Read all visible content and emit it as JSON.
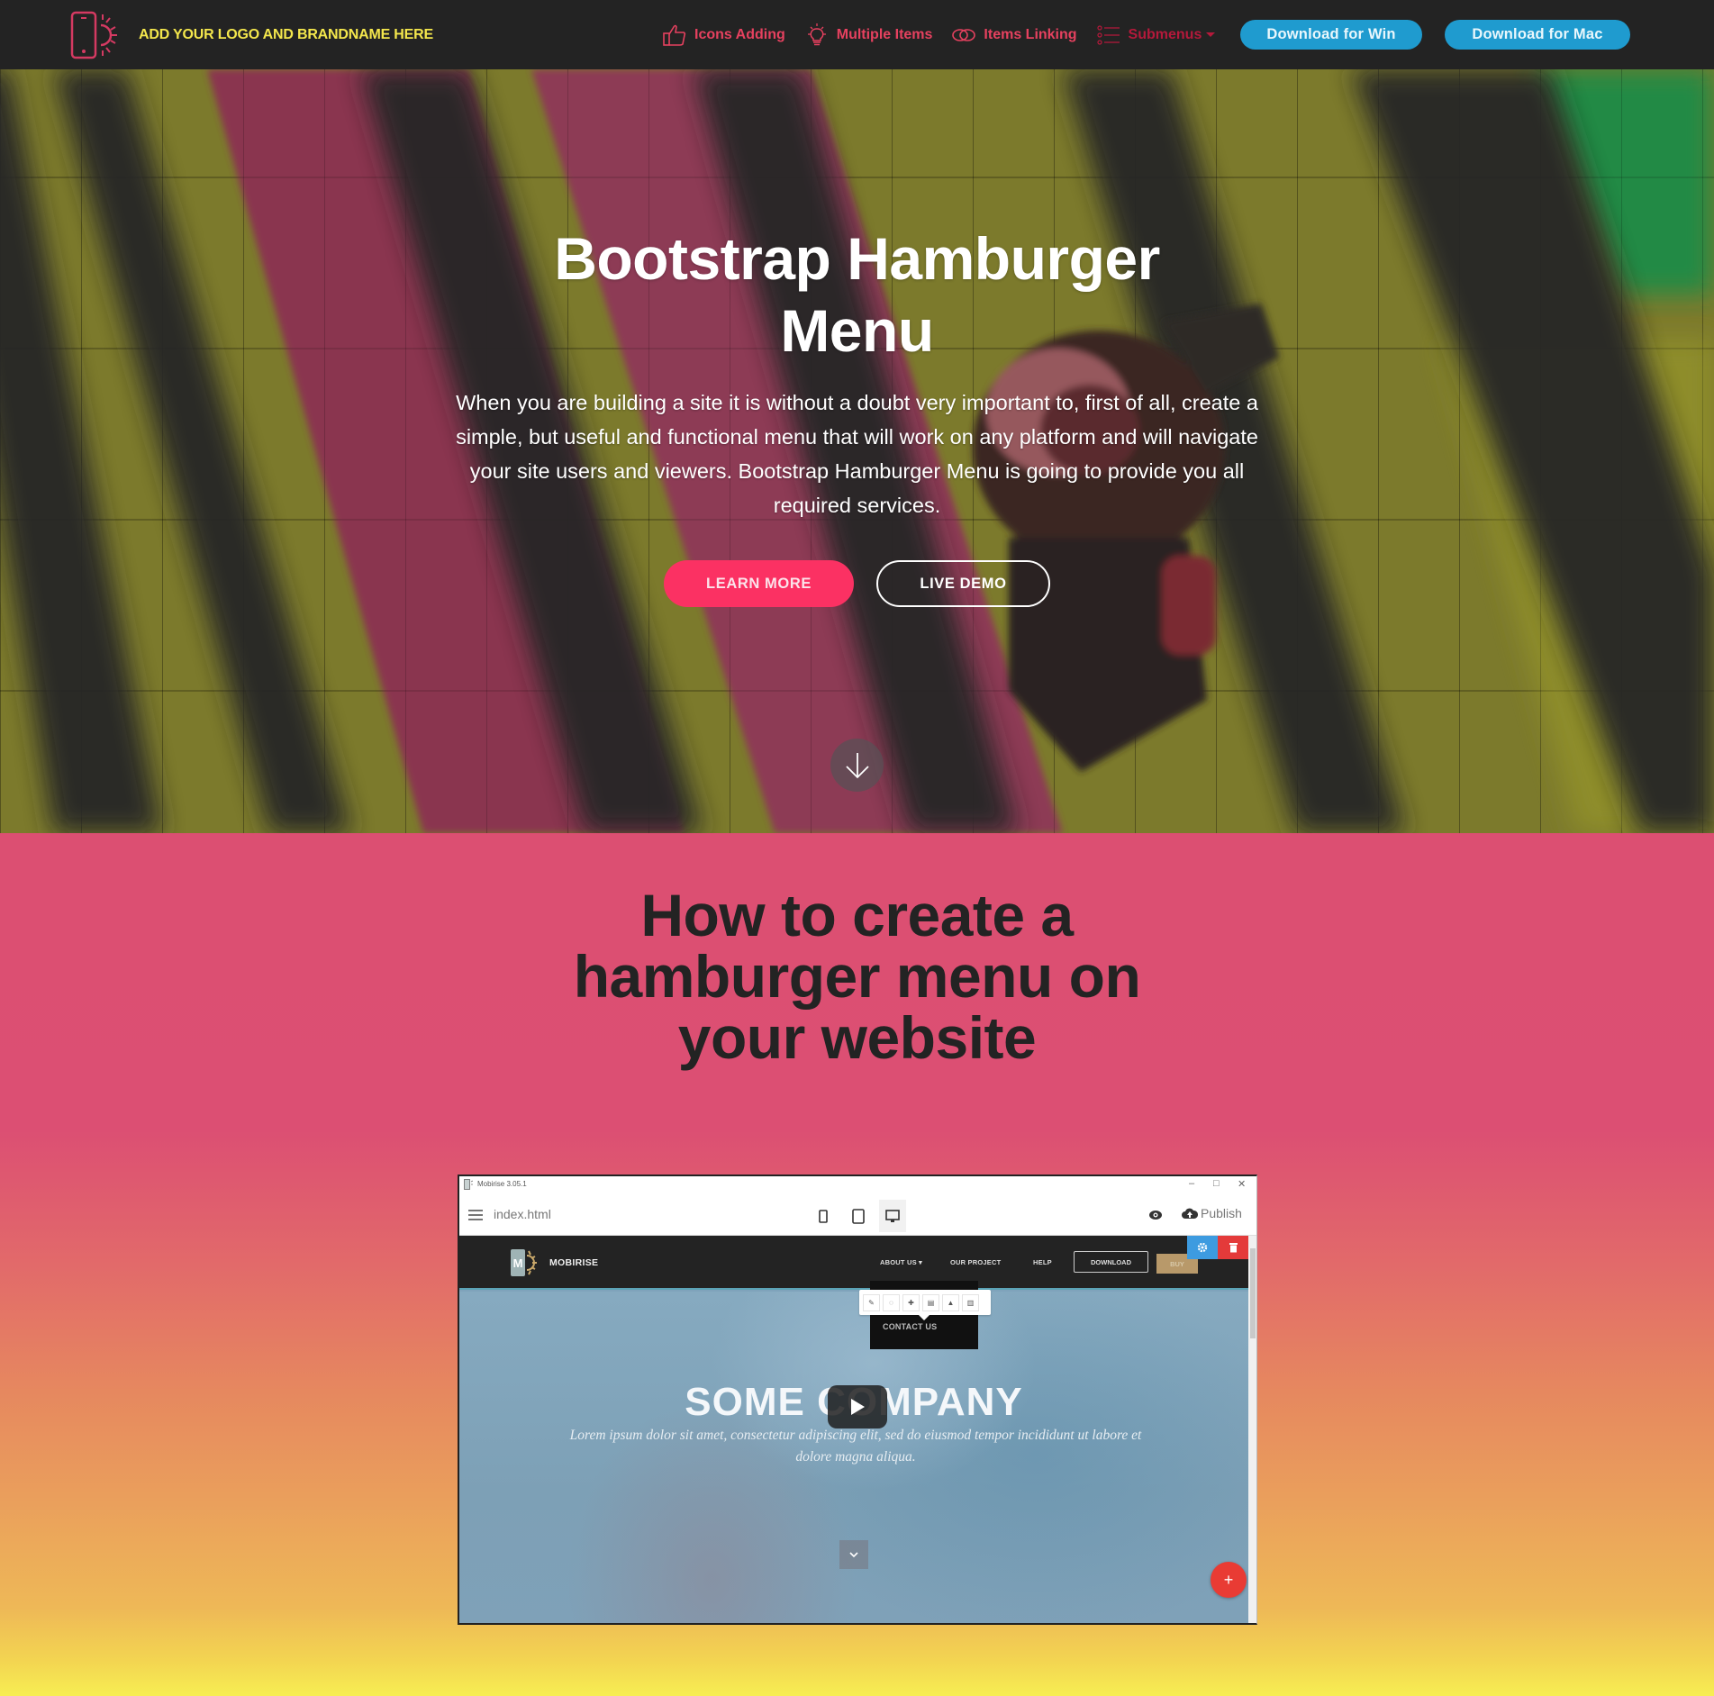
{
  "navbar": {
    "brand_name": "ADD YOUR LOGO AND BRANDNAME HERE",
    "links": [
      {
        "label": "Icons Adding",
        "icon": "thumbs-up-icon"
      },
      {
        "label": "Multiple Items",
        "icon": "lightbulb-icon"
      },
      {
        "label": "Items Linking",
        "icon": "link-icon"
      },
      {
        "label": "Submenus",
        "icon": "list-icon",
        "has_dropdown": true
      }
    ],
    "download_win": "Download for Win",
    "download_mac": "Download for Mac"
  },
  "hero": {
    "title_line1": "Bootstrap Hamburger",
    "title_line2": "Menu",
    "text": "When you are building a site it is without a doubt very important to, first of all, create a simple, but useful and functional menu that will work on any platform and will navigate your site users and viewers. Bootstrap Hamburger Menu is going to provide you all required services.",
    "learn_more": "LEARN MORE",
    "live_demo": "LIVE DEMO"
  },
  "howto": {
    "title_line1": "How to create a",
    "title_line2": "hamburger menu on",
    "title_line3": "your website"
  },
  "app": {
    "window_title": "Mobirise 3.05.1",
    "filename": "index.html",
    "publish": "Publish",
    "site": {
      "brand": "MOBIRISE",
      "nav": [
        "ABOUT US ▾",
        "OUR PROJECT",
        "HELP"
      ],
      "download": "DOWNLOAD",
      "buy": "BUY",
      "dropdown_item": "CONTACT US",
      "title": "SOME COMPANY",
      "subtitle": "Lorem ipsum dolor sit amet, consectetur adipiscing elit, sed do eiusmod tempor incididunt ut labore et dolore magna aliqua."
    }
  },
  "colors": {
    "navbar_bg": "#232323",
    "brand_yellow": "#f4e74c",
    "nav_pink": "#e6415f",
    "download_blue": "#1f9bcf",
    "cta_pink": "#fb3163",
    "section_pink": "#dc4f72",
    "section_yellow": "#f7ee53"
  }
}
